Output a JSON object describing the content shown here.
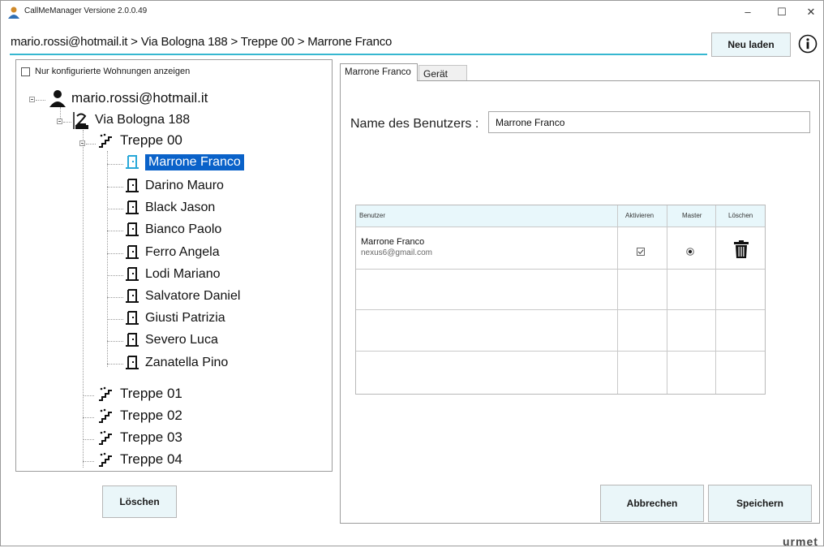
{
  "window": {
    "title": "CallMeManager Versione 2.0.0.49",
    "minimize": "–",
    "maximize": "☐",
    "close": "✕"
  },
  "header": {
    "breadcrumb": "mario.rossi@hotmail.it > Via Bologna 188 > Treppe 00 > Marrone Franco",
    "reload_label": "Neu laden",
    "accent_color": "#36b7d0"
  },
  "left": {
    "filter_label": "Nur konfigurierte Wohnungen anzeigen",
    "filter_checked": false,
    "tree": {
      "account": "mario.rossi@hotmail.it",
      "building": "Via Bologna 188",
      "staircase_open": "Treppe 00",
      "apartments": [
        "Marrone Franco",
        "Darino Mauro",
        "Black Jason",
        "Bianco Paolo",
        "Ferro Angela",
        "Lodi Mariano",
        "Salvatore Daniel",
        "Giusti Patrizia",
        "Severo Luca",
        "Zanatella Pino"
      ],
      "selected": "Marrone Franco",
      "staircases_other": [
        "Treppe 01",
        "Treppe 02",
        "Treppe 03",
        "Treppe 04"
      ]
    },
    "delete_label": "Löschen"
  },
  "right": {
    "tabs": [
      {
        "label": "Marrone Franco",
        "active": true
      },
      {
        "label": "Gerät",
        "active": false
      }
    ],
    "name_label": "Name des Benutzers :",
    "name_value": "Marrone Franco",
    "grid": {
      "headers": [
        "Benutzer",
        "Aktivieren",
        "Master",
        "Löschen"
      ],
      "rows": [
        {
          "name": "Marrone Franco",
          "email": "nexus6@gmail.com",
          "active": true,
          "master": true
        }
      ]
    },
    "cancel_label": "Abbrechen",
    "save_label": "Speichern"
  },
  "brand": "urmet",
  "selection_color": "#0a62c9"
}
